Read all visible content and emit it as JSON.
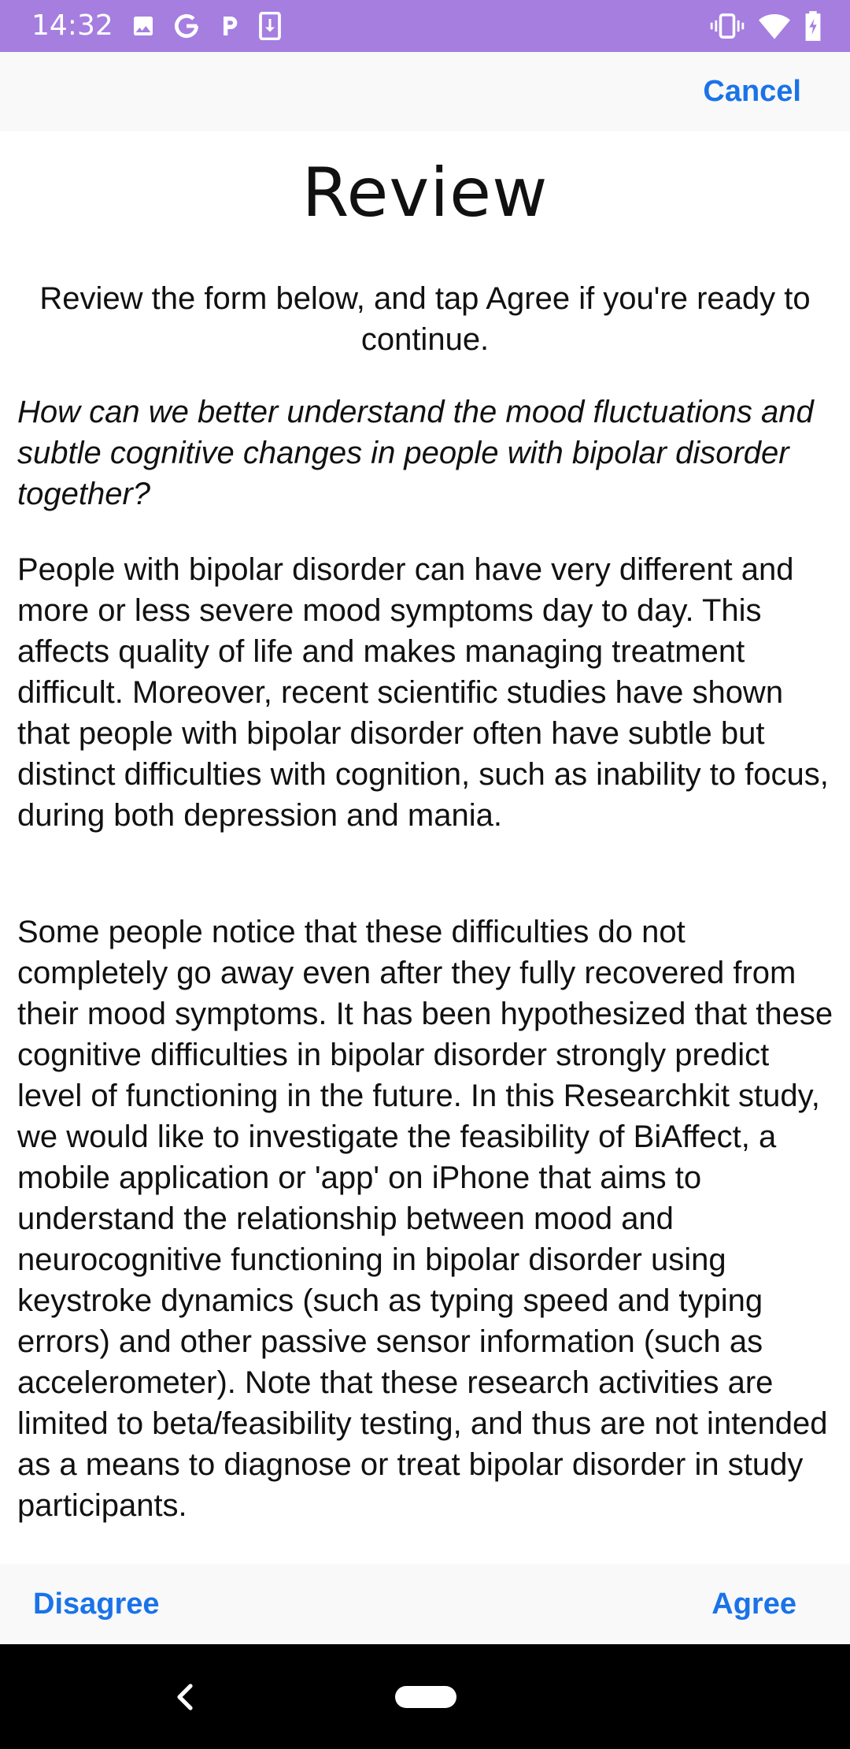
{
  "status_bar": {
    "time": "14:32",
    "background_color": "#a57ee0",
    "left_icons": [
      "image-icon",
      "google-icon",
      "parking-icon",
      "download-icon"
    ],
    "right_icons": [
      "vibrate-icon",
      "wifi-icon",
      "battery-icon"
    ]
  },
  "nav": {
    "cancel_label": "Cancel"
  },
  "review": {
    "title": "Review",
    "instruction": "Review the form below, and tap Agree if you're ready to continue.",
    "question": "How can we better understand the mood fluctuations and subtle cognitive changes in people with bipolar disorder together?",
    "paragraphs": [
      "People with bipolar disorder can have very different and more or less severe mood symptoms day to day. This affects quality of life and makes managing treatment difficult. Moreover, recent scientific studies have shown that people with bipolar disorder often have subtle but distinct difficulties with cognition, such as inability to focus, during both depression and mania.",
      "Some people notice that these difficulties do not completely go away even after they fully recovered from their mood symptoms. It has been hypothesized that these cognitive difficulties in bipolar disorder strongly predict level of functioning in the future. In this Researchkit study, we would like to investigate the feasibility of BiAffect, a mobile application or 'app' on iPhone that aims to understand the relationship between mood and neurocognitive functioning in bipolar disorder using keystroke dynamics (such as typing speed and typing errors) and other passive sensor information (such as accelerometer). Note that these research activities are limited to beta/feasibility testing, and thus are not intended as a means to diagnose or treat bipolar disorder in study participants."
    ]
  },
  "footer": {
    "disagree_label": "Disagree",
    "agree_label": "Agree"
  },
  "colors": {
    "accent": "#1a73e8",
    "bar_background": "#f9f9f9"
  },
  "system_nav": {
    "icons": [
      "back-icon",
      "home-pill-icon"
    ]
  }
}
